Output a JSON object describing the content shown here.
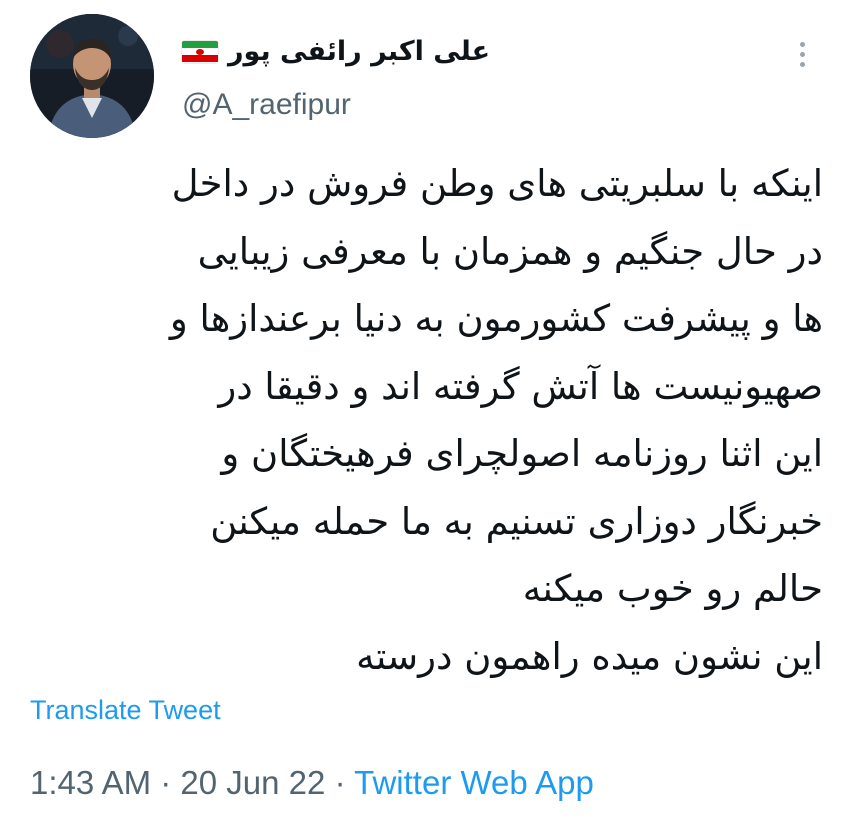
{
  "author": {
    "display_name": "علی اکبر رائفی پور",
    "flag_icon": "iran-flag-icon",
    "handle": "@A_raefipur",
    "avatar_icon": "profile-photo"
  },
  "more_icon": "more-options-icon",
  "tweet": {
    "lines": [
      "اینکه با سلبریتی های وطن فروش  در داخل",
      "در حال جنگیم و همزمان با معرفی زیبایی",
      "ها و پیشرفت کشورمون به دنیا برعندازها و",
      "صهیونیست ها آتش گرفته اند و دقیقا در",
      "این اثنا روزنامه اصولچرای فرهیختگان و",
      "خبرنگار دوزاری تسنیم به ما حمله میکنن",
      "حالم رو خوب میکنه",
      "این نشون میده راهمون درسته"
    ]
  },
  "translate_label": "Translate Tweet",
  "meta": {
    "time": "1:43 AM",
    "separator": "·",
    "date": "20 Jun 22",
    "source": "Twitter Web App"
  },
  "colors": {
    "text": "#0f1419",
    "secondary": "#536471",
    "link": "#1d9bf0"
  }
}
